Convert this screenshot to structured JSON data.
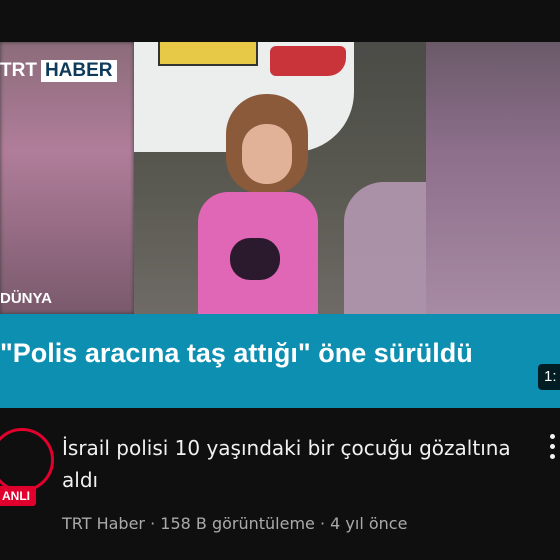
{
  "video": {
    "logo_part1": "TRT",
    "logo_part2": "HABER",
    "region_label": "DÜNYA",
    "caption": "\"Polis aracına taş attığı\" öne sürüldü",
    "duration": "1:"
  },
  "channel": {
    "avatar_badge": "ANLI"
  },
  "details": {
    "title": "İsrail polisi 10 yaşındaki bir çocuğu gözaltına aldı",
    "meta": "TRT Haber · 158 B görüntüleme · 4 yıl önce"
  },
  "colors": {
    "caption_bar": "#0d8fb1",
    "live_red": "#e1002d",
    "background": "#0f0f0f"
  },
  "icons": {
    "more": "more-vert-icon"
  }
}
